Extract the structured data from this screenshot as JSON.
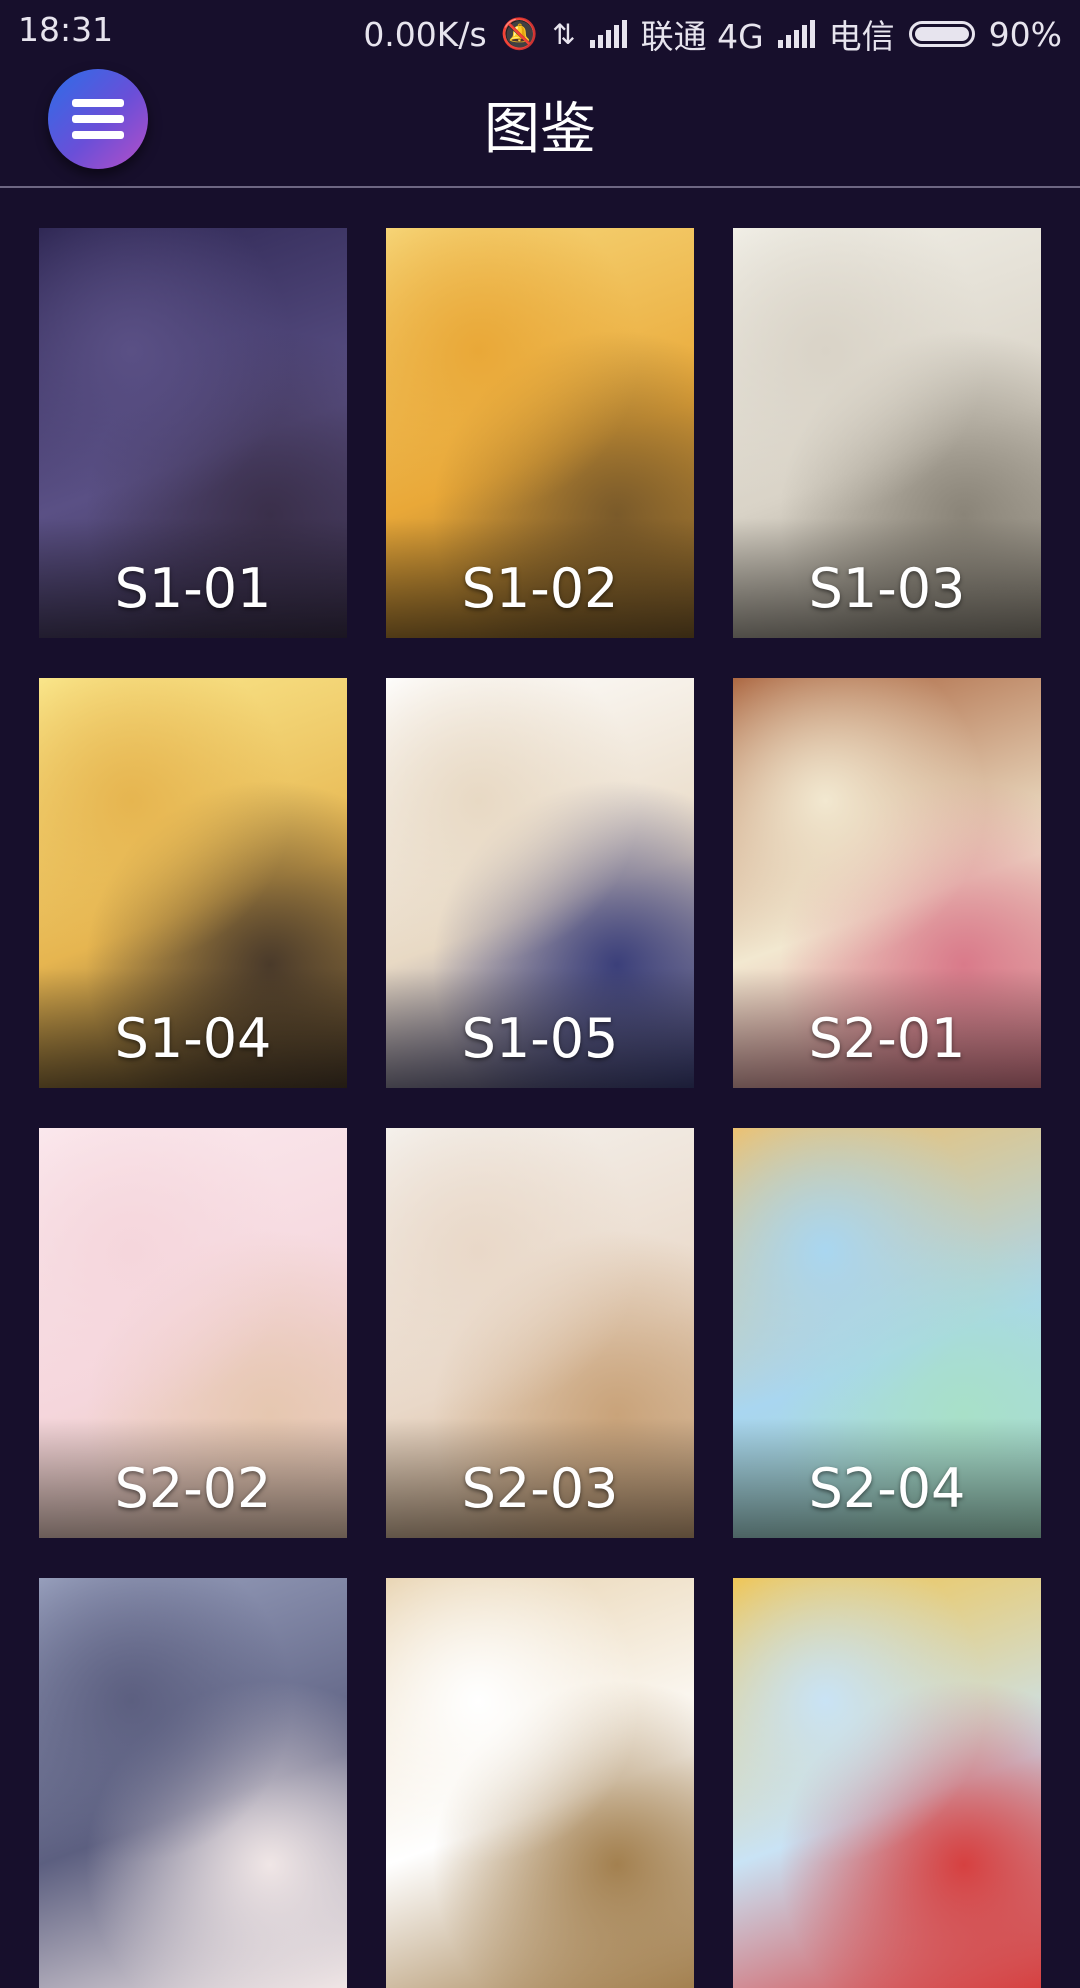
{
  "status_bar": {
    "time": "18:31",
    "net_speed": "0.00K/s",
    "carrier1": "联通 4G",
    "carrier2": "电信",
    "battery": "90%"
  },
  "app_bar": {
    "title": "图鉴",
    "menu_icon": "hamburger-menu-icon"
  },
  "gallery": {
    "items": [
      {
        "label": "S1-01",
        "colors": [
          "#2d2652",
          "#5a5085",
          "#3a2f4a"
        ]
      },
      {
        "label": "S1-02",
        "colors": [
          "#f7d77a",
          "#e9a838",
          "#7a5a2a"
        ]
      },
      {
        "label": "S1-03",
        "colors": [
          "#f2f0e8",
          "#d9d3c7",
          "#8a8478"
        ]
      },
      {
        "label": "S1-04",
        "colors": [
          "#fbe98e",
          "#e6b550",
          "#4a3a2a"
        ]
      },
      {
        "label": "S1-05",
        "colors": [
          "#ffffff",
          "#e8d9c4",
          "#3b3f7a"
        ]
      },
      {
        "label": "S2-01",
        "colors": [
          "#a8603a",
          "#f2e8d0",
          "#d97a8a"
        ]
      },
      {
        "label": "S2-02",
        "colors": [
          "#fbe9ee",
          "#f5d6dc",
          "#e6c7b0"
        ]
      },
      {
        "label": "S2-03",
        "colors": [
          "#f5f2ee",
          "#e9d8c8",
          "#c9a37a"
        ]
      },
      {
        "label": "S2-04",
        "colors": [
          "#f0c06a",
          "#a9d6f0",
          "#a8e0c8"
        ]
      },
      {
        "label": "",
        "colors": [
          "#9aa2bf",
          "#5c5f80",
          "#f0e6e6"
        ]
      },
      {
        "label": "",
        "colors": [
          "#e8d3b0",
          "#ffffff",
          "#a3804f"
        ]
      },
      {
        "label": "",
        "colors": [
          "#f2c44c",
          "#c9e3f5",
          "#d64040"
        ]
      }
    ]
  }
}
